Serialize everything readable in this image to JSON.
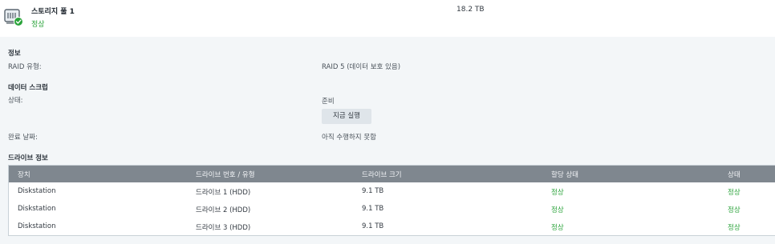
{
  "pool": {
    "name": "스토리지 풀 1",
    "status": "정상",
    "size": "18.2 TB",
    "icon": "storage-pool-icon",
    "status_color": "#2aa33a"
  },
  "info": {
    "title": "정보",
    "raid_label": "RAID 유형:",
    "raid_value": "RAID 5 (데이터 보호 있음)"
  },
  "scrub": {
    "title": "데이터 스크럽",
    "status_label": "상태:",
    "status_value": "준비",
    "run_button": "지금 실행",
    "completed_label": "완료 날짜:",
    "completed_value": "아직 수행하지 못함"
  },
  "drives": {
    "title": "드라이브 정보",
    "columns": [
      "장치",
      "드라이브 번호 / 유형",
      "드라이브 크기",
      "할당 상태",
      "상태"
    ],
    "rows": [
      {
        "device": "Diskstation",
        "drive": "드라이브 1 (HDD)",
        "size": "9.1 TB",
        "allocation": "정상",
        "status": "정상"
      },
      {
        "device": "Diskstation",
        "drive": "드라이브 2 (HDD)",
        "size": "9.1 TB",
        "allocation": "정상",
        "status": "정상"
      },
      {
        "device": "Diskstation",
        "drive": "드라이브 3 (HDD)",
        "size": "9.1 TB",
        "allocation": "정상",
        "status": "정상"
      }
    ]
  }
}
